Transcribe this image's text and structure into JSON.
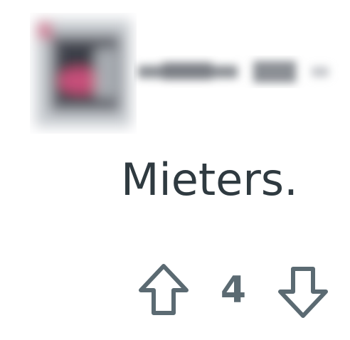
{
  "comment": {
    "body": "Mieters.",
    "score": "4"
  },
  "icons": {
    "upvote": "arrow-up-outline-icon",
    "downvote": "arrow-down-outline-icon"
  },
  "colors": {
    "text": "#2f3a40",
    "vote_icon": "#5b6a72",
    "score": "#5b6a72",
    "background": "#ffffff"
  }
}
